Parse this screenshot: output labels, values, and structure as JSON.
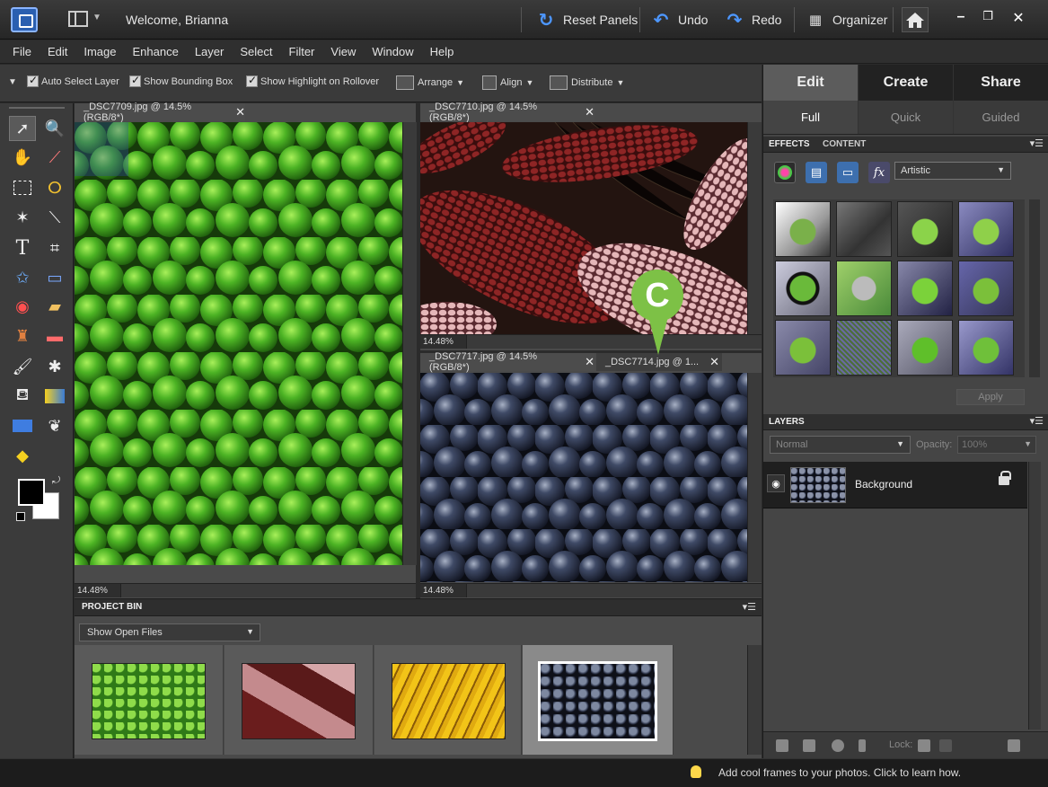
{
  "titlebar": {
    "welcome": "Welcome, Brianna",
    "reset_panels": "Reset Panels",
    "undo": "Undo",
    "redo": "Redo",
    "organizer": "Organizer"
  },
  "menu": [
    "File",
    "Edit",
    "Image",
    "Enhance",
    "Layer",
    "Select",
    "Filter",
    "View",
    "Window",
    "Help"
  ],
  "options": {
    "auto_select": "Auto Select Layer",
    "show_bounding": "Show Bounding Box",
    "show_highlight": "Show Highlight on Rollover",
    "arrange": "Arrange",
    "align": "Align",
    "distribute": "Distribute"
  },
  "documents": {
    "doc1": {
      "tab": "_DSC7709.jpg @ 14.5% (RGB/8*)",
      "zoom": "14.48%"
    },
    "doc2": {
      "tab": "_DSC7710.jpg @ 14.5% (RGB/8*)",
      "zoom": "14.48%"
    },
    "doc3": {
      "tab": "_DSC7717.jpg @ 14.5% (RGB/8*)",
      "zoom": "14.48%"
    },
    "doc4": {
      "tab": "_DSC7714.jpg @ 1..."
    }
  },
  "callout": "C",
  "project_bin": {
    "title": "PROJECT BIN",
    "select": "Show Open Files"
  },
  "panel": {
    "modes": [
      "Edit",
      "Create",
      "Share"
    ],
    "subtabs": [
      "Full",
      "Quick",
      "Guided"
    ],
    "effects_tab": "EFFECTS",
    "content_tab": "CONTENT",
    "effects_filter": "Artistic",
    "apply": "Apply",
    "layers_title": "LAYERS",
    "blend_mode": "Normal",
    "opacity_label": "Opacity:",
    "opacity_value": "100%",
    "layer_name": "Background",
    "lock_label": "Lock:"
  },
  "status": {
    "tip": "Add cool frames to your photos. Click to learn how."
  },
  "colors": {
    "accent_blue": "#4d97ff",
    "callout_green": "#7dc146"
  }
}
